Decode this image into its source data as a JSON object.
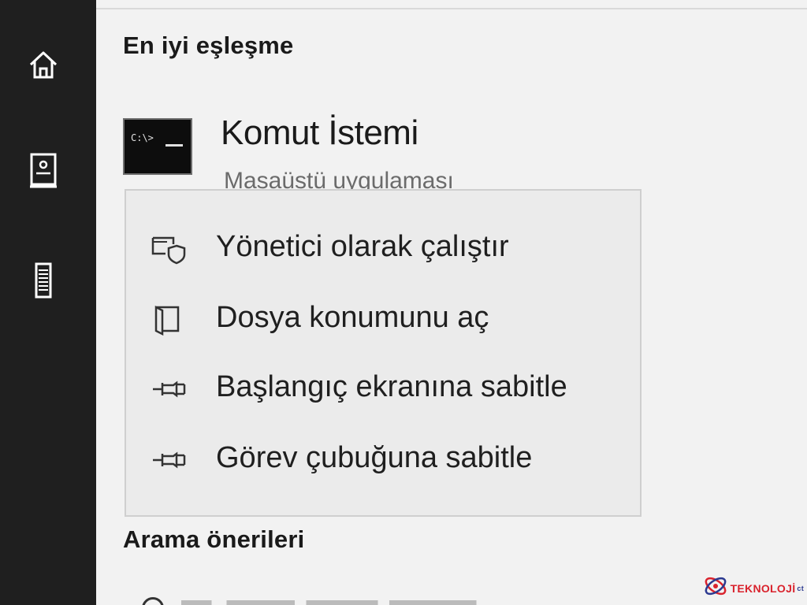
{
  "sidebar": {
    "items": [
      {
        "icon": "home-icon"
      },
      {
        "icon": "document-icon"
      },
      {
        "icon": "server-icon"
      }
    ]
  },
  "best_match": {
    "title": "En iyi eşleşme",
    "app": {
      "name": "Komut İstemi",
      "subtitle": "Masaüstü uygulaması",
      "icon": "command-prompt-icon",
      "icon_prompt_text": "C:\\>"
    }
  },
  "context_menu": {
    "items": [
      {
        "label": "Yönetici olarak çalıştır",
        "icon": "run-as-admin-icon"
      },
      {
        "label": "Dosya konumunu aç",
        "icon": "open-file-location-icon"
      },
      {
        "label": "Başlangıç ekranına sabitle",
        "icon": "pin-icon"
      },
      {
        "label": "Görev çubuğuna sabitle",
        "icon": "pin-icon"
      }
    ]
  },
  "suggestions": {
    "title": "Arama önerileri"
  },
  "watermark": {
    "text": "TEKNOLOJİ",
    "suffix": "ct"
  },
  "colors": {
    "sidebar_bg": "#1f1f1f",
    "panel_bg": "#f2f2f2",
    "menu_bg": "#ebebeb",
    "watermark_red": "#d9232d"
  }
}
